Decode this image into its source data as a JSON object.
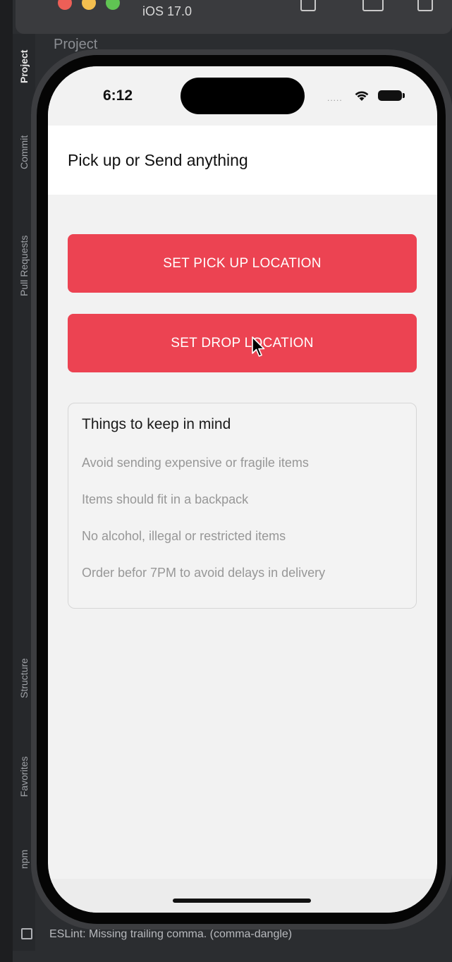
{
  "simulator": {
    "title": "iOS 17.0"
  },
  "ide": {
    "tabs": [
      "Project",
      "Commit",
      "Pull Requests",
      "Structure",
      "Favorites",
      "npm"
    ],
    "toolbar_label": "Project",
    "status_message": "ESLint: Missing trailing comma. (comma-dangle)"
  },
  "status_bar": {
    "time": "6:12",
    "signal": "....."
  },
  "header": {
    "title": "Pick up or Send anything"
  },
  "actions": {
    "pickup_label": "SET PICK UP LOCATION",
    "drop_label": "SET DROP LOCATION"
  },
  "info_card": {
    "title": "Things to keep in mind",
    "items": [
      "Avoid sending expensive or fragile items",
      "Items should fit in a backpack",
      "No alcohol, illegal or restricted items",
      "Order befor 7PM to avoid delays in delivery"
    ]
  },
  "colors": {
    "accent": "#ec4352",
    "background": "#f2f2f2",
    "card_border": "#d6d6d6",
    "muted_text": "#979797"
  }
}
